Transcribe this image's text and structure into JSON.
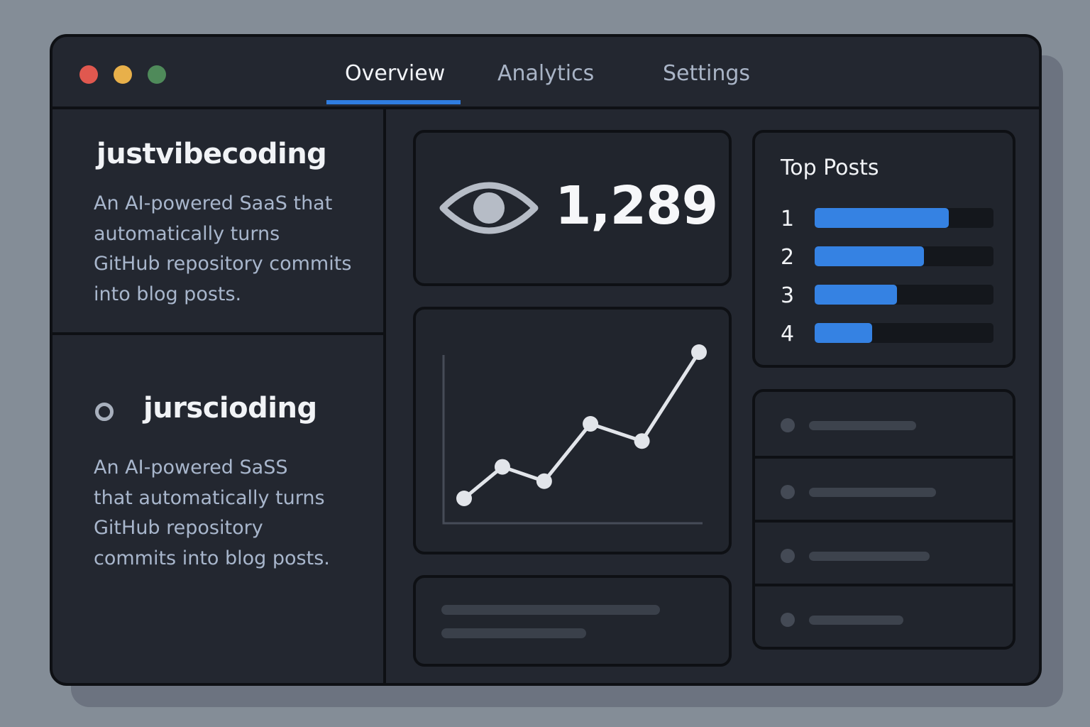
{
  "window": {
    "controls": [
      {
        "name": "close",
        "color": "#e0584f"
      },
      {
        "name": "minimize",
        "color": "#e8b04a"
      },
      {
        "name": "maximize",
        "color": "#4f8a5a"
      }
    ]
  },
  "tabs": [
    {
      "label": "Overview",
      "active": true
    },
    {
      "label": "Analytics",
      "active": false
    },
    {
      "label": "Settings",
      "active": false
    }
  ],
  "sidebar": {
    "projects": [
      {
        "name": "justvibecoding",
        "description": [
          "An AI-powered SaaS that",
          "automatically turns",
          "GitHub repository commits",
          "into blog posts."
        ]
      },
      {
        "name": "jurscioding",
        "icon": "ring-icon",
        "description": [
          "An AI-powered SaSS",
          "that automatically turns",
          "GitHub repository",
          "commits into blog posts."
        ]
      }
    ]
  },
  "views": {
    "icon": "eye-icon",
    "value": "1,289"
  },
  "trend": {
    "values": [
      1,
      2.1,
      1.6,
      3.6,
      3.0,
      6.1
    ]
  },
  "top_posts": {
    "title": "Top Posts",
    "items": [
      {
        "rank": "1",
        "share": 0.75
      },
      {
        "rank": "2",
        "share": 0.61
      },
      {
        "rank": "3",
        "share": 0.46
      },
      {
        "rank": "4",
        "share": 0.32
      }
    ],
    "accent": "#3582e3"
  },
  "colors": {
    "background": "#848d97",
    "window": "#232730",
    "accent": "#2f7de0"
  }
}
